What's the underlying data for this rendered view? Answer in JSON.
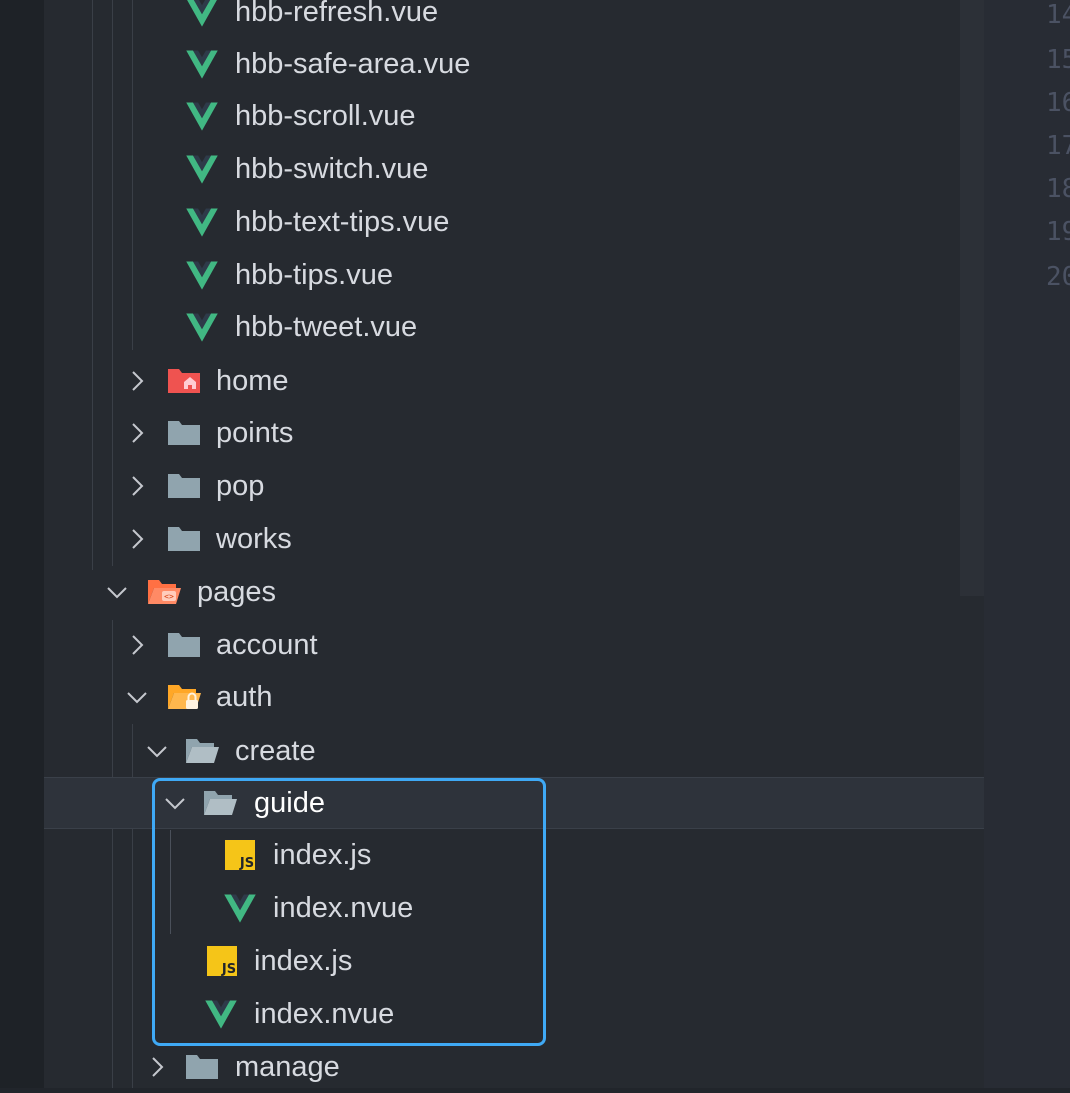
{
  "editor": {
    "line_numbers": [
      "14",
      "15",
      "16",
      "17",
      "18",
      "19",
      "20"
    ]
  },
  "tree": {
    "components": [
      {
        "label": "hbb-refresh.vue",
        "icon": "vue-icon"
      },
      {
        "label": "hbb-safe-area.vue",
        "icon": "vue-icon"
      },
      {
        "label": "hbb-scroll.vue",
        "icon": "vue-icon"
      },
      {
        "label": "hbb-switch.vue",
        "icon": "vue-icon"
      },
      {
        "label": "hbb-text-tips.vue",
        "icon": "vue-icon"
      },
      {
        "label": "hbb-tips.vue",
        "icon": "vue-icon"
      },
      {
        "label": "hbb-tweet.vue",
        "icon": "vue-icon"
      }
    ],
    "folders_a": [
      {
        "label": "home",
        "icon": "home-folder-icon"
      },
      {
        "label": "points",
        "icon": "folder-icon"
      },
      {
        "label": "pop",
        "icon": "folder-icon"
      },
      {
        "label": "works",
        "icon": "folder-icon"
      }
    ],
    "pages": {
      "label": "pages",
      "icon": "pages-folder-open-icon"
    },
    "account": {
      "label": "account",
      "icon": "folder-icon"
    },
    "auth": {
      "label": "auth",
      "icon": "lock-folder-open-icon"
    },
    "create": {
      "label": "create",
      "icon": "folder-open-icon"
    },
    "guide": {
      "label": "guide",
      "icon": "folder-open-icon"
    },
    "guide_files": [
      {
        "label": "index.js",
        "icon": "js-icon"
      },
      {
        "label": "index.nvue",
        "icon": "vue-icon"
      }
    ],
    "create_files": [
      {
        "label": "index.js",
        "icon": "js-icon"
      },
      {
        "label": "index.nvue",
        "icon": "vue-icon"
      }
    ],
    "manage": {
      "label": "manage",
      "icon": "folder-icon"
    }
  },
  "colors": {
    "vue": "#41b883",
    "folder": "#90a4ae",
    "home_folder": "#ef5350",
    "pages_folder": "#ff7043",
    "auth_folder": "#ffa726",
    "js": "#f5c518",
    "highlight": "#3fa9f5"
  }
}
